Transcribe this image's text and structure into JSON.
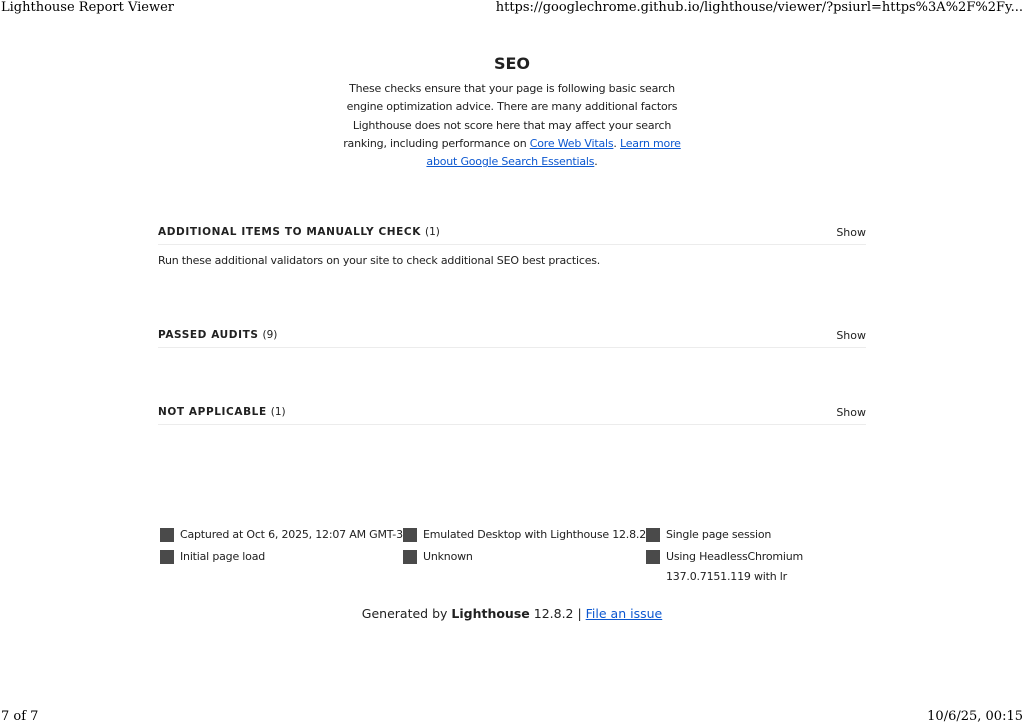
{
  "print_header": {
    "title": "Lighthouse Report Viewer",
    "url": "https://googlechrome.github.io/lighthouse/viewer/?psiurl=https%3A%2F%2Fy..."
  },
  "category": {
    "title": "SEO",
    "description_parts": {
      "text1": "These checks ensure that your page is following basic search engine optimization advice. There are many additional factors Lighthouse does not score here that may affect your search ranking, including performance on ",
      "link1": "Core Web Vitals",
      "text2": ". ",
      "link2": "Learn more about Google Search Essentials",
      "text3": "."
    }
  },
  "groups": [
    {
      "title": "Additional items to manually check",
      "count": "(1)",
      "toggle": "Show",
      "description": "Run these additional validators on your site to check additional SEO best practices."
    },
    {
      "title": "Passed audits",
      "count": "(9)",
      "toggle": "Show"
    },
    {
      "title": "Not applicable",
      "count": "(1)",
      "toggle": "Show"
    }
  ],
  "meta": [
    "Captured at Oct 6, 2025, 12:07 AM GMT-3",
    "Emulated Desktop with Lighthouse 12.8.2",
    "Single page session",
    "Initial page load",
    "Unknown",
    "Using HeadlessChromium 137.0.7151.119 with lr"
  ],
  "footer": {
    "generated_prefix": "Generated by ",
    "brand": "Lighthouse",
    "version": " 12.8.2 | ",
    "issue_link": "File an issue"
  },
  "print_footer": {
    "page": "7 of 7",
    "datetime": "10/6/25, 00:15"
  },
  "colors": {
    "link": "#0b57d0",
    "text": "#212121",
    "icon": "#4a4a4a"
  }
}
